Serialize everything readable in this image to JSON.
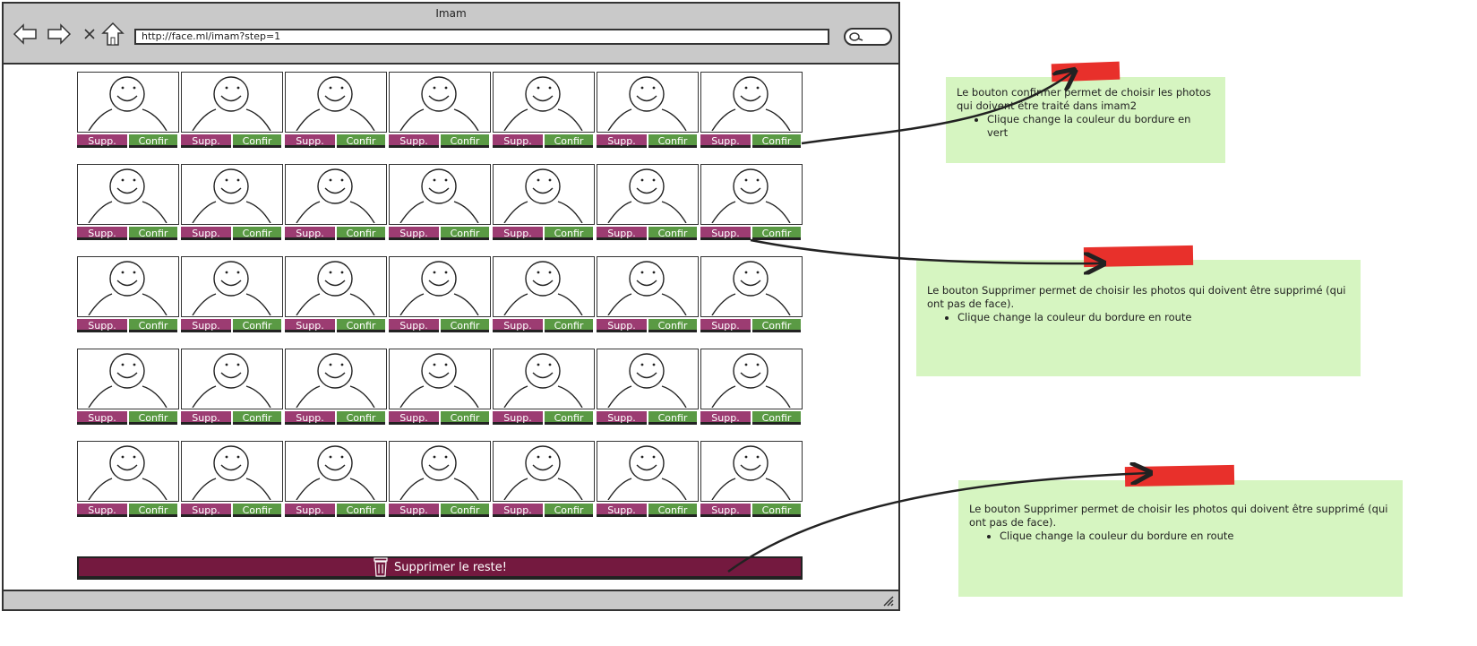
{
  "window": {
    "title": "Imam",
    "url": "http://face.ml/imam?step=1",
    "nav_icons": [
      "back-arrow-icon",
      "forward-arrow-icon",
      "close-x-icon",
      "home-icon"
    ]
  },
  "grid": {
    "rows": 5,
    "columns": 7,
    "supp_label": "Supp.",
    "confirm_label": "Confir",
    "colors": {
      "supp": "#9c3c72",
      "confirm": "#5a9a44"
    }
  },
  "delete_button": {
    "label": "Supprimer le reste!",
    "icon": "trash-icon",
    "color": "#74193f"
  },
  "notes": [
    {
      "text": "Le bouton confirmer permet de choisir les photos qui doivent être traité dans imam2",
      "bullet": "Clique change la couleur du bordure en vert"
    },
    {
      "text": "Le bouton Supprimer permet de choisir les photos qui doivent être supprimé (qui ont pas de face).",
      "bullet": "Clique change la couleur du bordure en route"
    },
    {
      "text": "Le bouton Supprimer permet de choisir les photos qui doivent être supprimé (qui ont pas de face).",
      "bullet": "Clique change la couleur du bordure en route"
    }
  ]
}
